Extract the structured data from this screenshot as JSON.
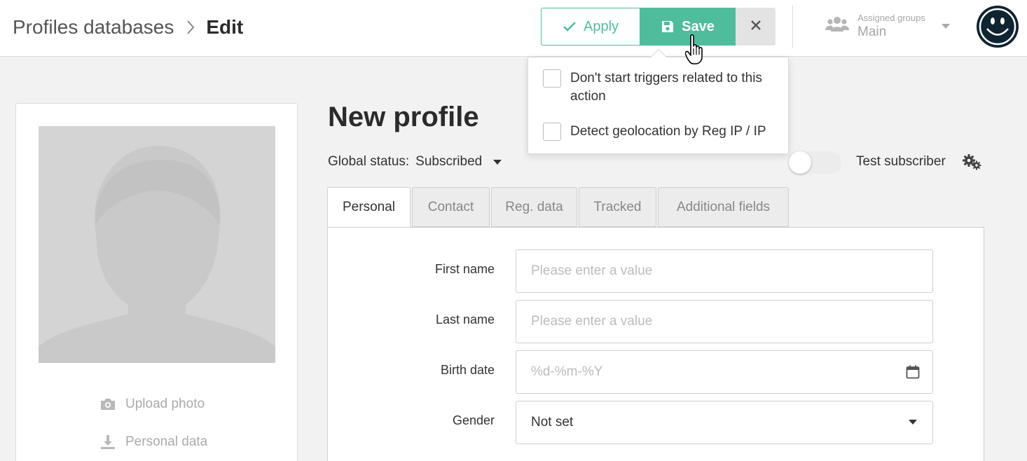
{
  "breadcrumb": {
    "root": "Profiles databases",
    "current": "Edit"
  },
  "toolbar": {
    "apply_label": "Apply",
    "save_label": "Save",
    "close_label": "×"
  },
  "save_options": [
    {
      "label": "Don't start triggers related to this action",
      "checked": false
    },
    {
      "label": "Detect geolocation by Reg IP / IP",
      "checked": false
    }
  ],
  "assigned_groups": {
    "label": "Assigned groups",
    "value": "Main"
  },
  "profile": {
    "title": "New profile",
    "global_status_label": "Global status:",
    "global_status_value": "Subscribed",
    "test_subscriber_label": "Test subscriber",
    "test_subscriber_on": false
  },
  "tabs": [
    {
      "label": "Personal",
      "active": true
    },
    {
      "label": "Contact",
      "active": false
    },
    {
      "label": "Reg. data",
      "active": false
    },
    {
      "label": "Tracked",
      "active": false
    },
    {
      "label": "Additional fields",
      "active": false
    }
  ],
  "form": {
    "first_name": {
      "label": "First name",
      "placeholder": "Please enter a value"
    },
    "last_name": {
      "label": "Last name",
      "placeholder": "Please enter a value"
    },
    "birth_date": {
      "label": "Birth date",
      "placeholder": "%d-%m-%Y"
    },
    "gender": {
      "label": "Gender",
      "value": "Not set"
    }
  },
  "card": {
    "upload_photo": "Upload photo",
    "personal_data": "Personal data"
  },
  "colors": {
    "accent": "#4fbd9c",
    "avatar_bg": "#0f2430",
    "avatar_face": "#ffffff"
  }
}
